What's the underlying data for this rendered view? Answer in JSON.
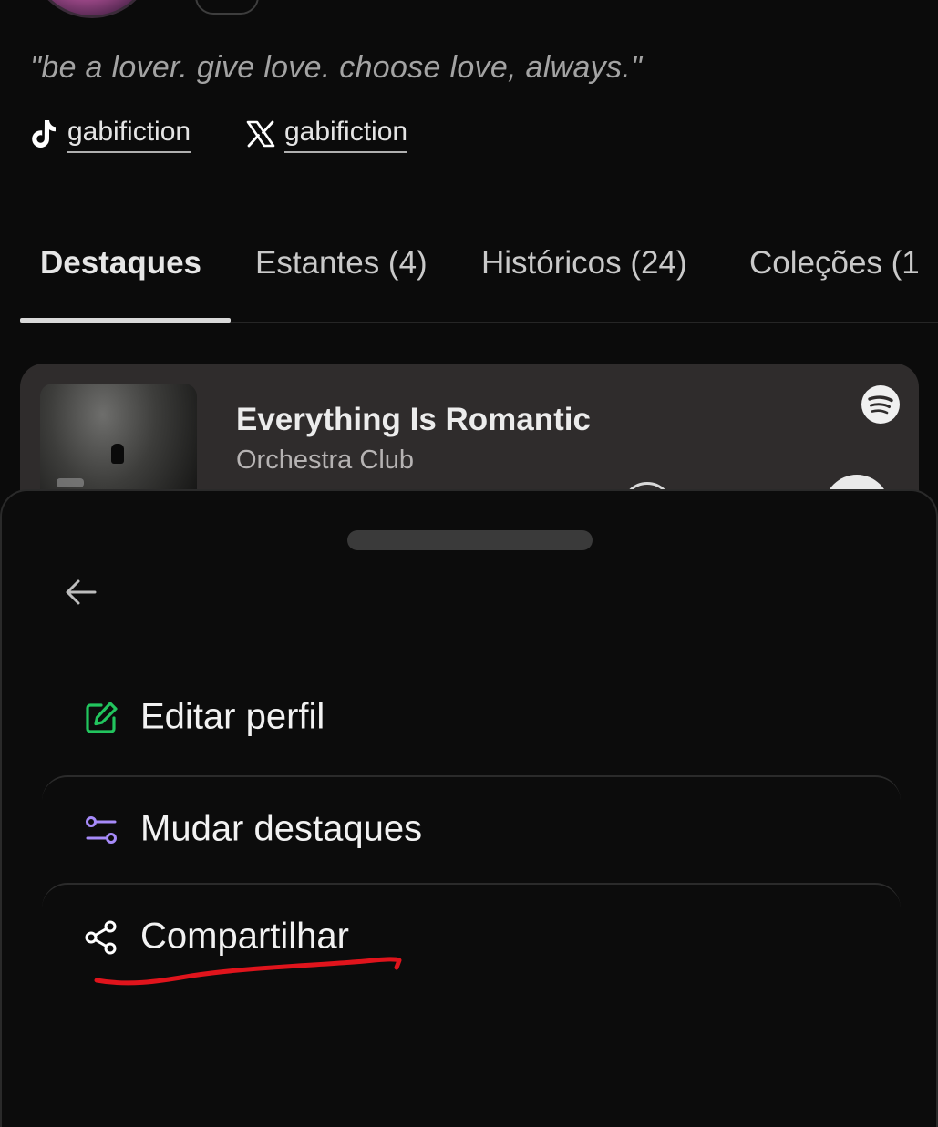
{
  "profile": {
    "bio": "\"be a lover. give love. choose love, always.\"",
    "socials": [
      {
        "network": "tiktok",
        "icon": "tiktok-icon",
        "handle": "gabifiction"
      },
      {
        "network": "x",
        "icon": "x-icon",
        "handle": "gabifiction"
      }
    ]
  },
  "tabs": [
    {
      "label": "Destaques",
      "active": true
    },
    {
      "label": "Estantes (4)",
      "active": false
    },
    {
      "label": "Históricos (24)",
      "active": false
    },
    {
      "label": "Coleções (1",
      "active": false
    }
  ],
  "music_card": {
    "title": "Everything Is Romantic",
    "artist": "Orchestra Club",
    "source_icon": "spotify-icon"
  },
  "sheet": {
    "back_icon": "arrow-left-icon",
    "items": [
      {
        "label": "Editar perfil",
        "icon": "edit-icon",
        "icon_color": "#22c55e"
      },
      {
        "label": "Mudar destaques",
        "icon": "sliders-icon",
        "icon_color": "#a78bfa"
      },
      {
        "label": "Compartilhar",
        "icon": "share-icon",
        "icon_color": "#ffffff"
      }
    ],
    "annotation_color": "#e0141c"
  },
  "colors": {
    "background": "#0b0b0b",
    "card": "#2f2c2c",
    "sheet": "#0c0c0c"
  }
}
